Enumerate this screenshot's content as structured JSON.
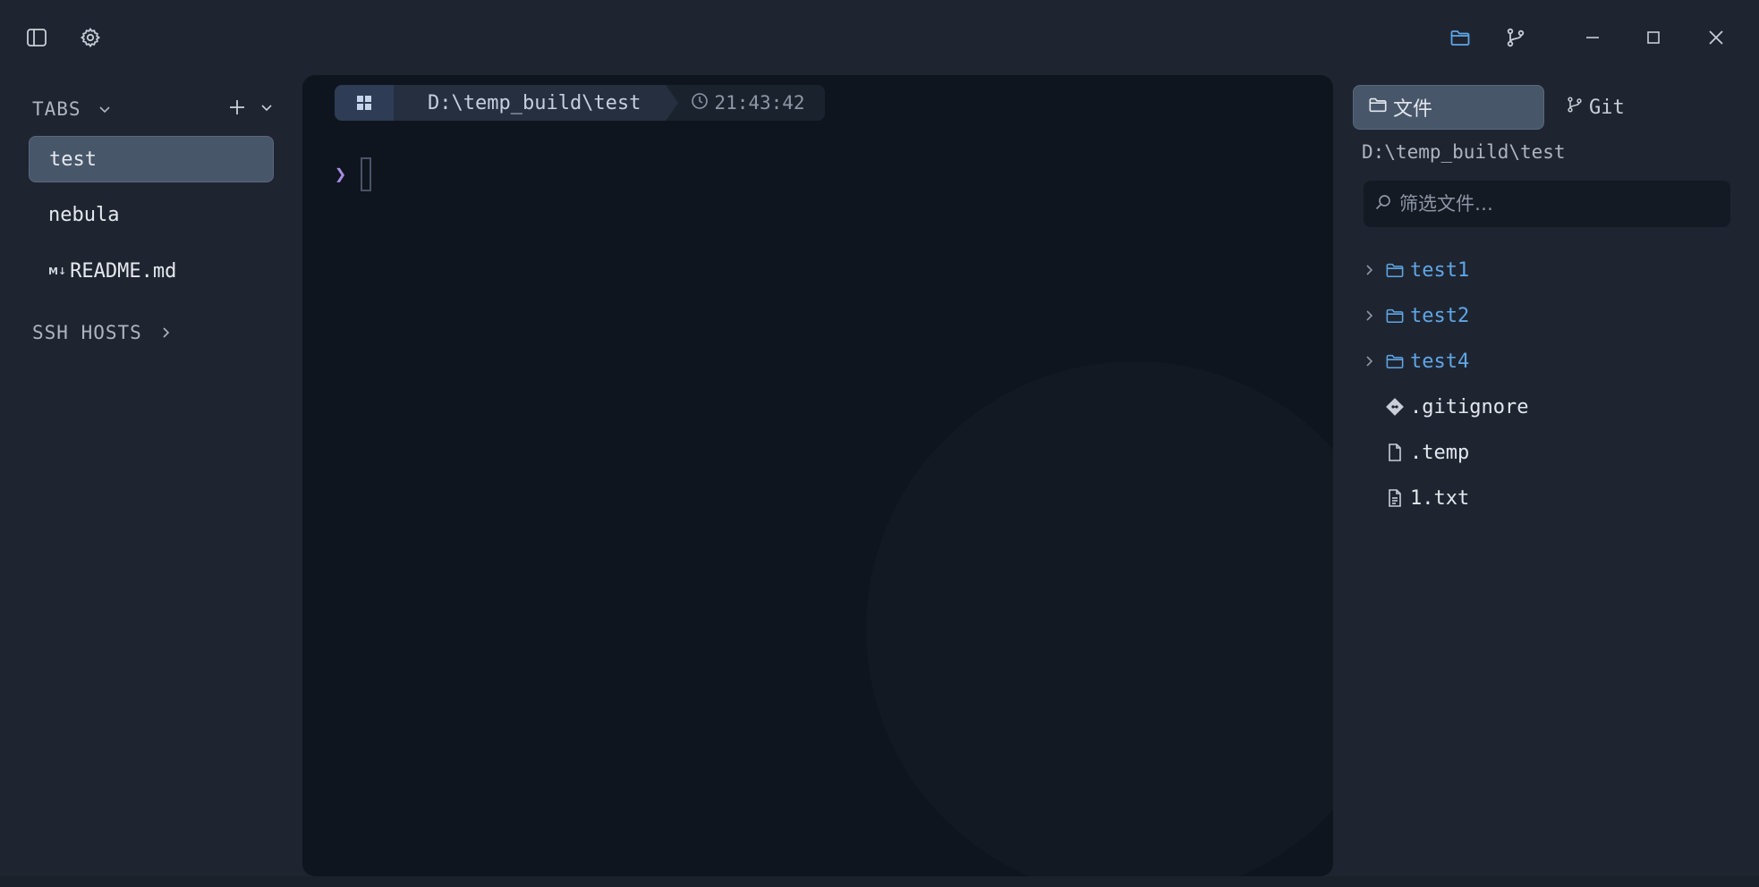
{
  "sidebar": {
    "tabs_heading": "TABS",
    "tabs": [
      {
        "label": "test",
        "active": true
      },
      {
        "label": "nebula",
        "active": false
      },
      {
        "label": "README.md",
        "badge": "M↓",
        "active": false
      }
    ],
    "ssh_heading": "SSH HOSTS"
  },
  "terminal": {
    "os_icon": "windows-icon",
    "path": "D:\\temp_build\\test",
    "time": "21:43:42",
    "prompt_symbol": "❯"
  },
  "right_panel": {
    "tabs": [
      {
        "label": "文件",
        "icon": "folder-icon",
        "active": true
      },
      {
        "label": "Git",
        "icon": "git-branch-icon",
        "active": false
      }
    ],
    "cwd": "D:\\temp_build\\test",
    "filter_placeholder": "筛选文件…",
    "tree": [
      {
        "name": "test1",
        "type": "folder"
      },
      {
        "name": "test2",
        "type": "folder"
      },
      {
        "name": "test4",
        "type": "folder"
      },
      {
        "name": ".gitignore",
        "type": "git"
      },
      {
        "name": ".temp",
        "type": "file"
      },
      {
        "name": "1.txt",
        "type": "text"
      }
    ]
  },
  "colors": {
    "accent": "#5fa6e8",
    "prompt": "#a98de0",
    "terminal_bg": "#0f151e",
    "window_bg": "#1f2530"
  }
}
